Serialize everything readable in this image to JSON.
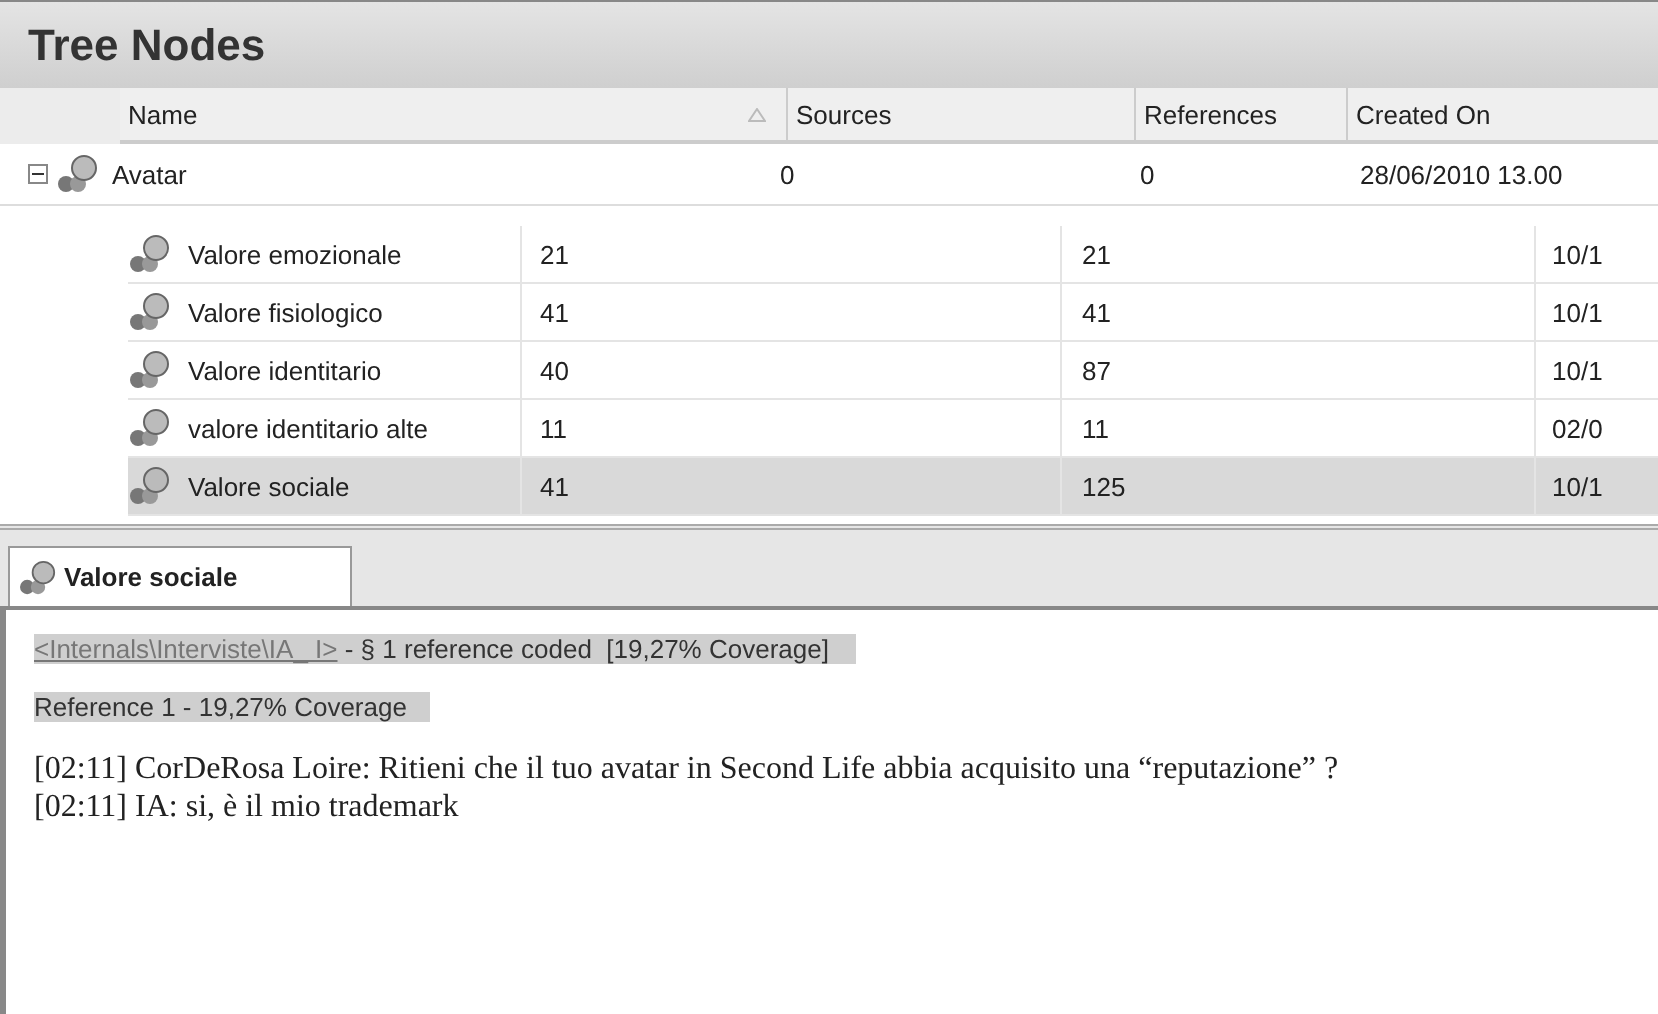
{
  "panel_title": "Tree Nodes",
  "columns": [
    "Name",
    "Sources",
    "References",
    "Created On"
  ],
  "root": {
    "name": "Avatar",
    "sources": "0",
    "references": "0",
    "created": "28/06/2010 13.00",
    "expanded": true,
    "children": [
      {
        "name": "Valore emozionale",
        "sources": "21",
        "references": "21",
        "created": "10/1",
        "selected": false
      },
      {
        "name": "Valore fisiologico",
        "sources": "41",
        "references": "41",
        "created": "10/1",
        "selected": false
      },
      {
        "name": "Valore identitario",
        "sources": "40",
        "references": "87",
        "created": "10/1",
        "selected": false
      },
      {
        "name": "valore identitario alte",
        "sources": "11",
        "references": "11",
        "created": "02/0",
        "selected": false
      },
      {
        "name": "Valore sociale",
        "sources": "41",
        "references": "125",
        "created": "10/1",
        "selected": true
      }
    ]
  },
  "detail_tab": {
    "label": "Valore sociale",
    "selected": true
  },
  "detail": {
    "source_link": "<Internals\\Interviste\\IA_ I>",
    "source_summary": " - § 1 reference coded  [19,27% Coverage]",
    "reference_heading": "Reference 1 - 19,27% Coverage",
    "transcript": [
      "[02:11] CorDeRosa Loire: Ritieni che il tuo avatar in Second Life abbia acquisito una “reputazione” ?",
      "[02:11] IA: si, è il mio trademark"
    ]
  }
}
